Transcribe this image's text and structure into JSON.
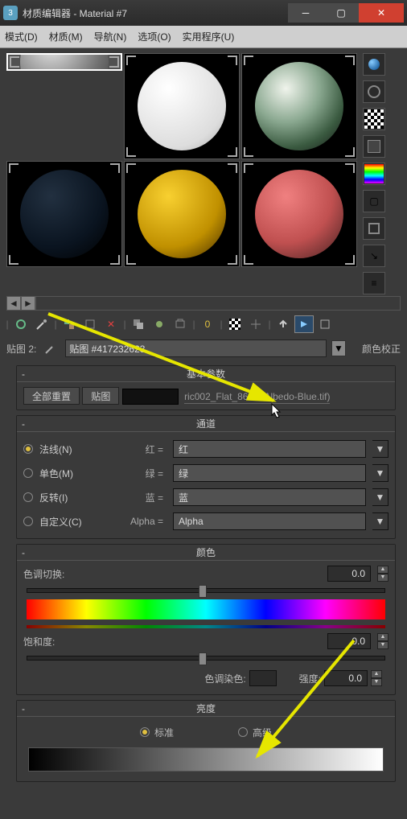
{
  "window": {
    "title": "材质编辑器 - Material #7"
  },
  "menu": {
    "mode": "模式(D)",
    "material": "材质(M)",
    "navigate": "导航(N)",
    "options": "选项(O)",
    "utils": "实用程序(U)"
  },
  "map_row": {
    "label": "贴图 2:",
    "combo_value": "贴图 #417232623",
    "color_correct": "颜色校正"
  },
  "panel_basic": {
    "title": "基本参数",
    "reset_all": "全部重置",
    "map_btn": "贴图",
    "map_name": "ric002_Flat_86cm-Albedo-Blue.tif)"
  },
  "panel_channel": {
    "title": "通道",
    "normal": "法线(N)",
    "mono": "单色(M)",
    "invert": "反转(I)",
    "custom": "自定义(C)",
    "red_lbl": "红 =",
    "green_lbl": "绿 =",
    "blue_lbl": "蓝 =",
    "alpha_lbl": "Alpha =",
    "red_val": "红",
    "green_val": "绿",
    "blue_val": "蓝",
    "alpha_val": "Alpha"
  },
  "panel_color": {
    "title": "颜色",
    "hue_shift": "色调切换:",
    "hue_val": "0.0",
    "saturation": "饱和度:",
    "sat_val": "0.0",
    "tint_label": "色调染色:",
    "strength": "强度:",
    "strength_val": "0.0"
  },
  "panel_bright": {
    "title": "亮度",
    "standard": "标准",
    "advanced": "高级"
  },
  "icons": {
    "sphere": "sphere",
    "checker": "checker",
    "spectrum": "spectrum"
  }
}
